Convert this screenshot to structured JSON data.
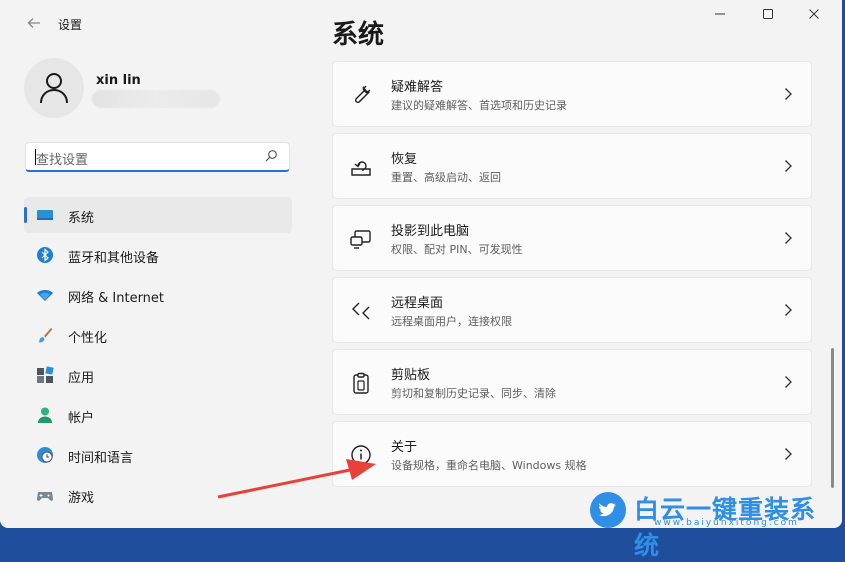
{
  "window": {
    "title": "设置",
    "back_icon": "arrow-left-icon"
  },
  "profile": {
    "name": "xin lin"
  },
  "search": {
    "placeholder": "查找设置"
  },
  "nav": [
    {
      "label": "系统",
      "icon": "monitor-icon",
      "active": true
    },
    {
      "label": "蓝牙和其他设备",
      "icon": "bluetooth-icon"
    },
    {
      "label": "网络 & Internet",
      "icon": "wifi-icon"
    },
    {
      "label": "个性化",
      "icon": "brush-icon"
    },
    {
      "label": "应用",
      "icon": "apps-icon"
    },
    {
      "label": "帐户",
      "icon": "person-icon"
    },
    {
      "label": "时间和语言",
      "icon": "globe-clock-icon"
    },
    {
      "label": "游戏",
      "icon": "gamepad-icon"
    }
  ],
  "main": {
    "title": "系统",
    "cards": [
      {
        "title": "疑难解答",
        "subtitle": "建议的疑难解答、首选项和历史记录",
        "icon": "wrench-icon"
      },
      {
        "title": "恢复",
        "subtitle": "重置、高级启动、返回",
        "icon": "recovery-icon"
      },
      {
        "title": "投影到此电脑",
        "subtitle": "权限、配对 PIN、可发现性",
        "icon": "project-icon"
      },
      {
        "title": "远程桌面",
        "subtitle": "远程桌面用户，连接权限",
        "icon": "remote-desktop-icon"
      },
      {
        "title": "剪贴板",
        "subtitle": "剪切和复制历史记录、同步、清除",
        "icon": "clipboard-icon"
      },
      {
        "title": "关于",
        "subtitle": "设备规格，重命名电脑、Windows 规格",
        "icon": "info-icon"
      }
    ]
  },
  "watermark": {
    "text": "白云一键重装系统",
    "url": "www.baiyunxitong.com"
  },
  "colors": {
    "accent": "#2b6fd0",
    "annotation_arrow": "#e8413a",
    "watermark": "#2f8ee6"
  }
}
